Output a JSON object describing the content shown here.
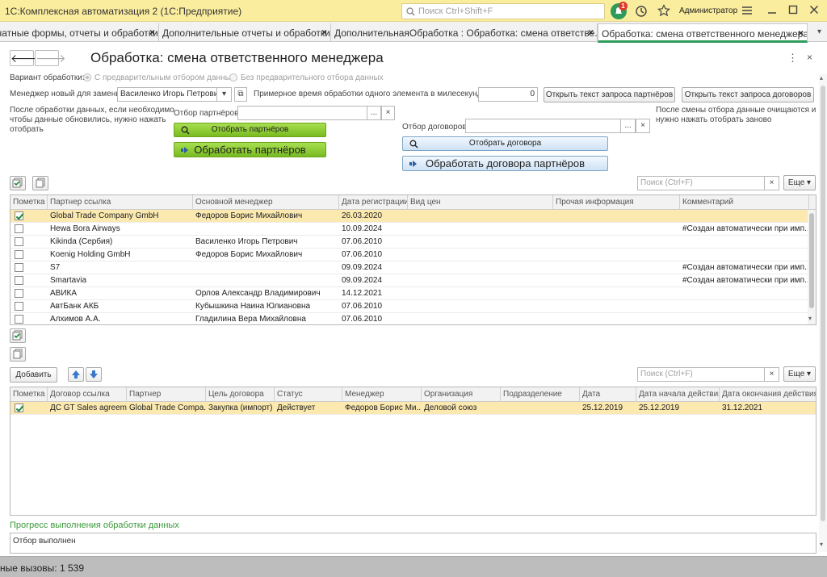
{
  "app": {
    "title": "1С:Комплексная автоматизация 2  (1С:Предприятие)",
    "search_placeholder": "Поиск Ctrl+Shift+F",
    "notification_count": "1",
    "user": "Администратор"
  },
  "tabs": [
    {
      "label": "чатные формы, отчеты и обработки",
      "active": false
    },
    {
      "label": "Дополнительные отчеты и обработки",
      "active": false
    },
    {
      "label": "ДополнительнаяОбработка : Обработка: смена ответстве...",
      "active": false
    },
    {
      "label": "Обработка: смена ответственного менеджера",
      "active": true
    }
  ],
  "form": {
    "title": "Обработка: смена ответственного менеджера",
    "variant_label": "Вариант обработки:",
    "variant_opt1": "С предварительным отбором данных",
    "variant_opt2": "Без предварительного отбора данных",
    "manager_label": "Менеджер новый для замены:",
    "manager_value": "Василенко Игорь Петрович",
    "time_label": "Примерное время обработки одного элемента в милесекундах:",
    "time_value": "0",
    "btn_query_partners": "Открыть текст запроса партнёров",
    "btn_query_contracts": "Открыть текст запроса договоров",
    "note_left_1": "После обработки данных, если необходимо",
    "note_left_2": "чтобы данные обновились, нужно нажать",
    "note_left_3": "отобрать",
    "note_right_1": "После смены отбора данные очищаются и",
    "note_right_2": "нужно нажать отобрать заново",
    "partner_filter_label": "Отбор партнёров:",
    "partner_filter_value": "",
    "contract_filter_label": "Отбор договоров:",
    "contract_filter_value": "",
    "btn_select_partners": "Отобрать партнёров",
    "btn_process_partners": "Обработать партнёров",
    "btn_select_contracts": "Отобрать договора",
    "btn_process_contracts": "Обработать договора партнёров",
    "search_placeholder": "Поиск (Ctrl+F)",
    "more_label": "Еще",
    "add_label": "Добавить",
    "progress_title": "Прогресс выполнения обработки данных",
    "progress_text": "Отбор выполнен"
  },
  "partners_table": {
    "columns": [
      "Пометка",
      "Партнер ссылка",
      "Основной менеджер",
      "Дата регистрации",
      "Вид цен",
      "Прочая информация",
      "Комментарий"
    ],
    "rows": [
      {
        "checked": true,
        "partner": "Global Trade Company GmbH",
        "manager": "Федоров Борис Михайлович",
        "date": "26.03.2020",
        "price": "",
        "info": "",
        "comment": ""
      },
      {
        "checked": false,
        "partner": "Hewa Bora Airways",
        "manager": "",
        "date": "10.09.2024",
        "price": "",
        "info": "",
        "comment": "#Создан автоматически при имп..."
      },
      {
        "checked": false,
        "partner": "Kikinda (Сербия)",
        "manager": "Василенко Игорь Петрович",
        "date": "07.06.2010",
        "price": "",
        "info": "",
        "comment": ""
      },
      {
        "checked": false,
        "partner": "Koenig Holding GmbH",
        "manager": "Федоров Борис Михайлович",
        "date": "07.06.2010",
        "price": "",
        "info": "",
        "comment": ""
      },
      {
        "checked": false,
        "partner": "S7",
        "manager": "",
        "date": "09.09.2024",
        "price": "",
        "info": "",
        "comment": "#Создан автоматически при имп..."
      },
      {
        "checked": false,
        "partner": "Smartavia",
        "manager": "",
        "date": "09.09.2024",
        "price": "",
        "info": "",
        "comment": "#Создан автоматически при имп..."
      },
      {
        "checked": false,
        "partner": "АВИКА",
        "manager": "Орлов Александр Владимирович",
        "date": "14.12.2021",
        "price": "",
        "info": "",
        "comment": ""
      },
      {
        "checked": false,
        "partner": "АвтБанк АКБ",
        "manager": "Кубышкина Наина Юлиановна",
        "date": "07.06.2010",
        "price": "",
        "info": "",
        "comment": ""
      },
      {
        "checked": false,
        "partner": "Алхимов А.А.",
        "manager": "Гладилина Вера Михайловна",
        "date": "07.06.2010",
        "price": "",
        "info": "",
        "comment": ""
      }
    ]
  },
  "contracts_table": {
    "columns": [
      "Пометка",
      "Договор ссылка",
      "Партнер",
      "Цель договора",
      "Статус",
      "Менеджер",
      "Организация",
      "Подразделение",
      "Дата",
      "Дата начала действия",
      "Дата окончания действия"
    ],
    "rows": [
      {
        "checked": true,
        "contract": "ДС GT Sales agreem...",
        "partner": "Global Trade Compa...",
        "goal": "Закупка (импорт)",
        "status": "Действует",
        "manager": "Федоров Борис Ми...",
        "org": "Деловой союз",
        "dept": "",
        "date": "25.12.2019",
        "start": "25.12.2019",
        "end": "31.12.2021"
      }
    ]
  },
  "status": {
    "text": "ные вызовы: 1 539"
  },
  "colors": {
    "titlebar": "#fbed9e",
    "accent_green": "#2d9b5c",
    "selected_row": "#fbe9b0"
  }
}
